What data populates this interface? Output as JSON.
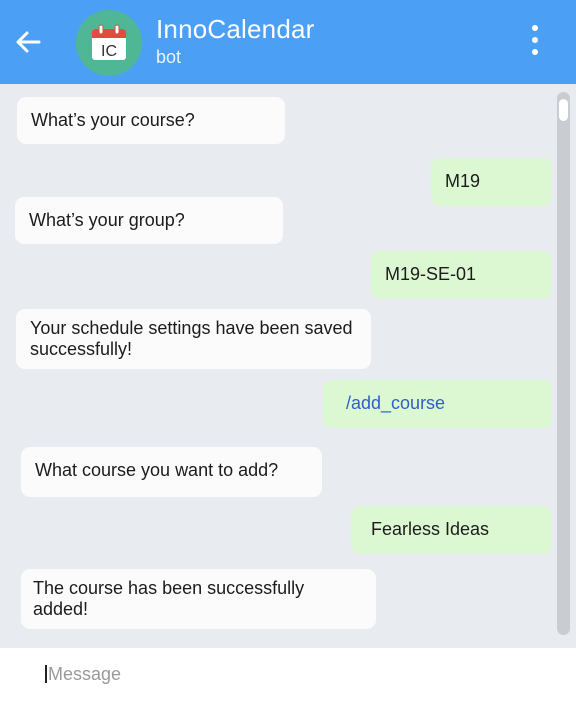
{
  "header": {
    "title": "InnoCalendar",
    "subtitle": "bot",
    "avatar_text": "IC",
    "back_icon": "arrow-left-icon",
    "menu_icon": "more-vertical-icon",
    "colors": {
      "bar": "#4ba0f5",
      "avatar": "#4fb795",
      "calendar_red": "#e24b3f"
    }
  },
  "messages": [
    {
      "from": "bot",
      "text": "What’s your course?"
    },
    {
      "from": "user",
      "text": "M19"
    },
    {
      "from": "bot",
      "text": "What’s your group?"
    },
    {
      "from": "user",
      "text": "M19-SE-01"
    },
    {
      "from": "bot",
      "text": "Your schedule settings have been saved successfully!"
    },
    {
      "from": "user",
      "text": "/add_course"
    },
    {
      "from": "bot",
      "text": "What course you want to add?"
    },
    {
      "from": "user",
      "text": "Fearless Ideas"
    },
    {
      "from": "bot",
      "text": "The course has been successfully added!"
    }
  ],
  "composer": {
    "placeholder": "Message",
    "value": ""
  },
  "colors": {
    "background": "#e8ebef",
    "incoming_bubble": "#fbfbfb",
    "outgoing_bubble": "#dcf8d2",
    "command_text": "#2d61c4"
  }
}
